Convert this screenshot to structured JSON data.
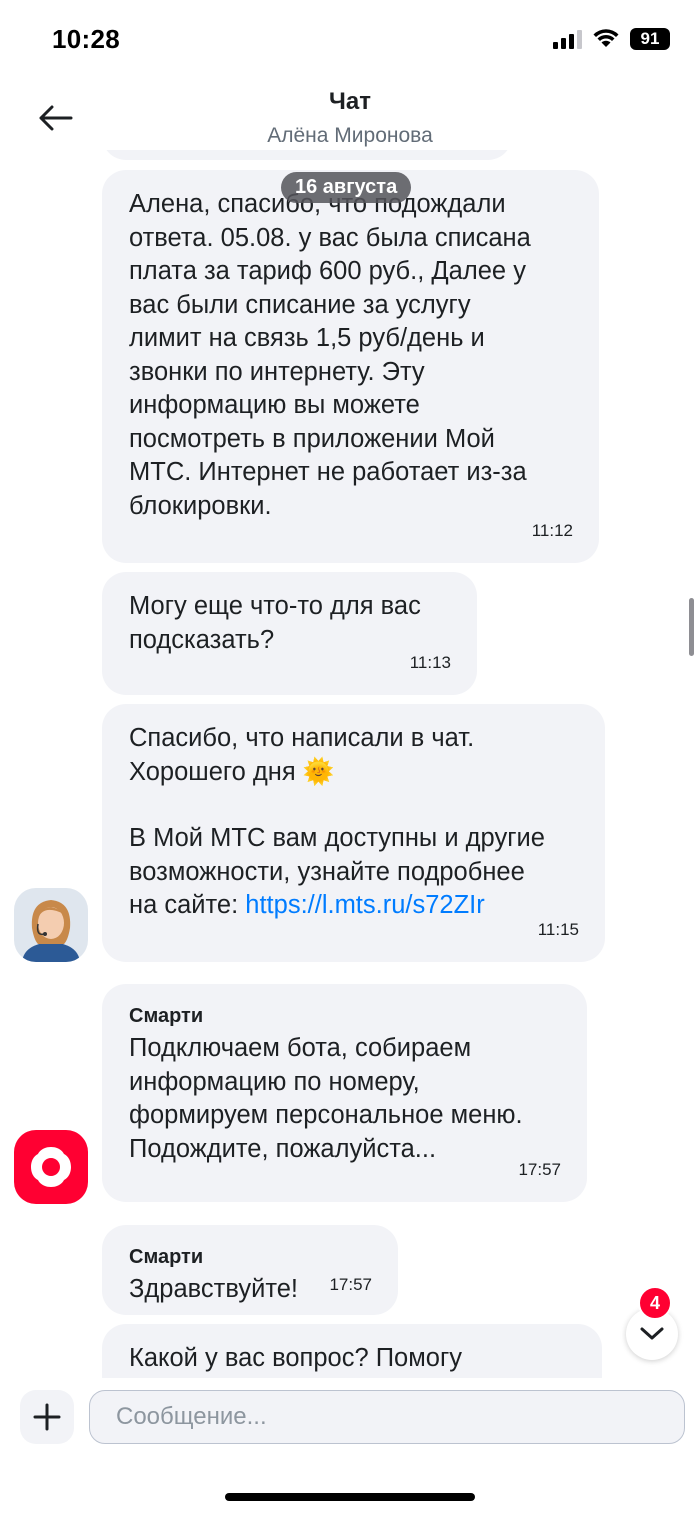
{
  "status_bar": {
    "time": "10:28",
    "battery": "91"
  },
  "header": {
    "title": "Чат",
    "subtitle": "Алёна Миронова"
  },
  "date_divider": "16 августа",
  "messages": [
    {
      "text": "Алена, спасибо, что подождали\nответа. 05.08. у вас была списана\nплата за тариф 600 руб., Далее у\nвас были списание за услугу\nлимит на связь 1,5 руб/день и\nзвонки по интернету. Эту\nинформацию вы можете\nпосмотреть в приложении Мой\nМТС. Интернет не работает из-за\nблокировки.",
      "time": "11:12"
    },
    {
      "text": "Могу еще что-то для вас\nподсказать?",
      "time": "11:13"
    },
    {
      "text_line1": "Спасибо, что написали в чат.",
      "text_line2": "Хорошего дня",
      "emoji": "🌞",
      "text_line3": "В Мой МТС вам доступны и другие\nвозможности, узнайте подробнее",
      "link_prefix": "на сайте: ",
      "link": "https://l.mts.ru/s72ZIr",
      "time": "11:15"
    },
    {
      "sender": "Смарти",
      "text": "Подключаем бота, собираем\nинформацию по номеру,\nформируем персональное меню.\nПодождите, пожалуйста...",
      "time": "17:57"
    },
    {
      "sender": "Смарти",
      "text": "Здравствуйте!",
      "time": "17:57"
    },
    {
      "text": "Какой у вас вопрос? Помогу"
    }
  ],
  "unread_badge": "4",
  "composer": {
    "placeholder": "Сообщение..."
  },
  "colors": {
    "accent_red": "#ff0032",
    "link_blue": "#007cff",
    "bubble_bg": "#f2f3f7"
  },
  "icons": [
    "back-arrow-icon",
    "signal-icon",
    "wifi-icon",
    "battery-icon",
    "operator-avatar",
    "smarti-logo-icon",
    "chevron-down-icon",
    "plus-icon"
  ]
}
